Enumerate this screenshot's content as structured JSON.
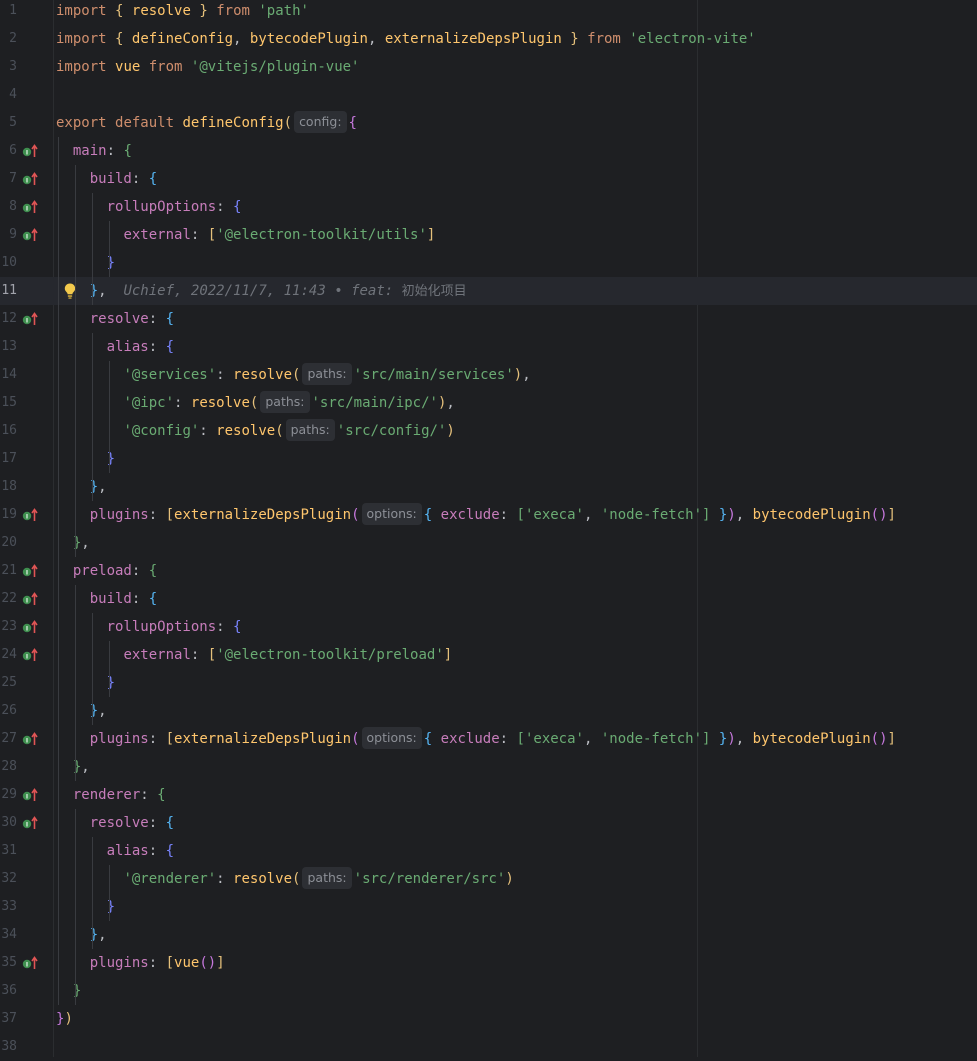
{
  "editor": {
    "file_language": "javascript",
    "current_line": 11,
    "blame": {
      "author": "Uchief",
      "date": "2022/11/7, 11:43",
      "separator": "•",
      "message_prefix": "feat:",
      "message": "初始化项目"
    },
    "line_numbers": [
      "1",
      "2",
      "3",
      "4",
      "5",
      "6",
      "7",
      "8",
      "9",
      "10",
      "11",
      "12",
      "13",
      "14",
      "15",
      "16",
      "17",
      "18",
      "19",
      "20",
      "21",
      "22",
      "23",
      "24",
      "25",
      "26",
      "27",
      "28",
      "29",
      "30",
      "31",
      "32",
      "33",
      "34",
      "35",
      "36",
      "37",
      "38"
    ],
    "override_marks_on_lines": [
      6,
      7,
      8,
      9,
      12,
      19,
      21,
      22,
      23,
      24,
      27,
      29,
      30,
      35
    ],
    "code": {
      "l1": {
        "kw1": "import",
        "b1": "{",
        "id": "resolve",
        "b2": "}",
        "kw2": "from",
        "str": "'path'"
      },
      "l2": {
        "kw1": "import",
        "b1": "{",
        "id1": "defineConfig",
        "c1": ",",
        "id2": "bytecodePlugin",
        "c2": ",",
        "id3": "externalizeDepsPlugin",
        "b2": "}",
        "kw2": "from",
        "str": "'electron-vite'"
      },
      "l3": {
        "kw1": "import",
        "id": "vue",
        "kw2": "from",
        "str": "'@vitejs/plugin-vue'"
      },
      "l5": {
        "kw1": "export",
        "kw2": "default",
        "fn": "defineConfig",
        "p": "(",
        "hint": "config:",
        "b": "{"
      },
      "l6": {
        "prop": "main",
        "colon": ":",
        "b": "{"
      },
      "l7": {
        "prop": "build",
        "colon": ":",
        "b": "{"
      },
      "l8": {
        "prop": "rollupOptions",
        "colon": ":",
        "b": "{"
      },
      "l9": {
        "prop": "external",
        "colon": ":",
        "br1": "[",
        "str": "'@electron-toolkit/utils'",
        "br2": "]"
      },
      "l10": {
        "b": "}"
      },
      "l11": {
        "b": "}",
        "c": ","
      },
      "l12": {
        "prop": "resolve",
        "colon": ":",
        "b": "{"
      },
      "l13": {
        "prop": "alias",
        "colon": ":",
        "b": "{"
      },
      "l14": {
        "key": "'@services'",
        "colon": ":",
        "fn": "resolve",
        "p1": "(",
        "hint": "paths:",
        "str": "'src/main/services'",
        "p2": ")",
        "c": ","
      },
      "l15": {
        "key": "'@ipc'",
        "colon": ":",
        "fn": "resolve",
        "p1": "(",
        "hint": "paths:",
        "str": "'src/main/ipc/'",
        "p2": ")",
        "c": ","
      },
      "l16": {
        "key": "'@config'",
        "colon": ":",
        "fn": "resolve",
        "p1": "(",
        "hint": "paths:",
        "str": "'src/config/'",
        "p2": ")"
      },
      "l17": {
        "b": "}"
      },
      "l18": {
        "b": "}",
        "c": ","
      },
      "l19": {
        "prop": "plugins",
        "colon": ":",
        "br1": "[",
        "fn1": "externalizeDepsPlugin",
        "p1": "(",
        "hint": "options:",
        "b1": "{",
        "prop2": "exclude",
        "colon2": ":",
        "br2": "[",
        "s1": "'execa'",
        "c1": ",",
        "s2": "'node-fetch'",
        "br3": "]",
        "b2": "}",
        "p2": ")",
        "c2": ",",
        "fn2": "bytecodePlugin",
        "p3": "()",
        "br4": "]"
      },
      "l20": {
        "b": "}",
        "c": ","
      },
      "l21": {
        "prop": "preload",
        "colon": ":",
        "b": "{"
      },
      "l22": {
        "prop": "build",
        "colon": ":",
        "b": "{"
      },
      "l23": {
        "prop": "rollupOptions",
        "colon": ":",
        "b": "{"
      },
      "l24": {
        "prop": "external",
        "colon": ":",
        "br1": "[",
        "str": "'@electron-toolkit/preload'",
        "br2": "]"
      },
      "l25": {
        "b": "}"
      },
      "l26": {
        "b": "}",
        "c": ","
      },
      "l27": {
        "prop": "plugins",
        "colon": ":",
        "br1": "[",
        "fn1": "externalizeDepsPlugin",
        "p1": "(",
        "hint": "options:",
        "b1": "{",
        "prop2": "exclude",
        "colon2": ":",
        "br2": "[",
        "s1": "'execa'",
        "c1": ",",
        "s2": "'node-fetch'",
        "br3": "]",
        "b2": "}",
        "p2": ")",
        "c2": ",",
        "fn2": "bytecodePlugin",
        "p3": "()",
        "br4": "]"
      },
      "l28": {
        "b": "}",
        "c": ","
      },
      "l29": {
        "prop": "renderer",
        "colon": ":",
        "b": "{"
      },
      "l30": {
        "prop": "resolve",
        "colon": ":",
        "b": "{"
      },
      "l31": {
        "prop": "alias",
        "colon": ":",
        "b": "{"
      },
      "l32": {
        "key": "'@renderer'",
        "colon": ":",
        "fn": "resolve",
        "p1": "(",
        "hint": "paths:",
        "str": "'src/renderer/src'",
        "p2": ")"
      },
      "l33": {
        "b": "}"
      },
      "l34": {
        "b": "}",
        "c": ","
      },
      "l35": {
        "prop": "plugins",
        "colon": ":",
        "br1": "[",
        "fn": "vue",
        "p": "()",
        "br2": "]"
      },
      "l36": {
        "b": "}"
      },
      "l37": {
        "b": "}",
        "p": ")"
      }
    }
  },
  "colors": {
    "background": "#1e1f22",
    "keyword": "#cf8e6d",
    "function": "#ffc66d",
    "string": "#6aab73",
    "property": "#c77dbb",
    "hint_bg": "#2d2f34",
    "current_line_bg": "#26282e"
  },
  "icons": {
    "gutter_mark": "implements-override-up-arrow-icon",
    "intention": "lightbulb-icon"
  }
}
